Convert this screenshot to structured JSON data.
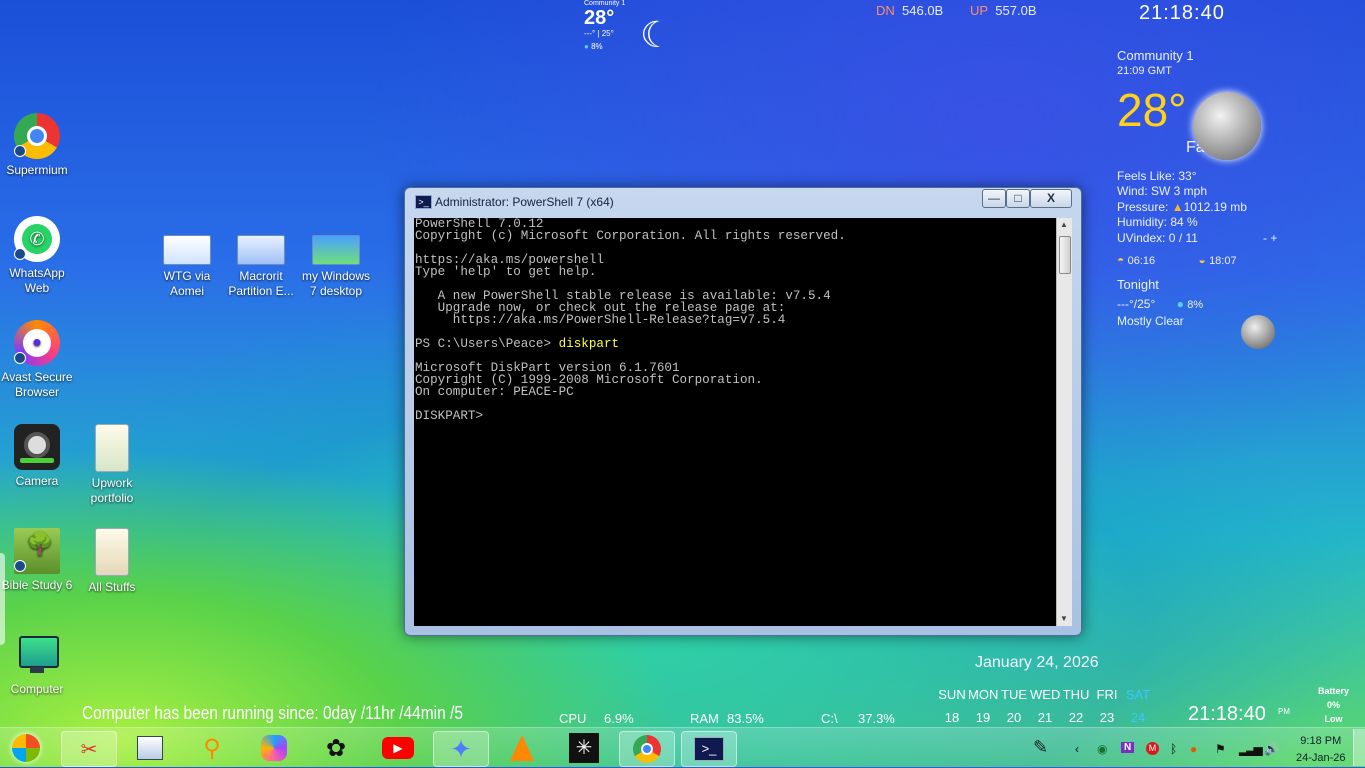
{
  "desktop_icons": [
    {
      "label": "Supermium"
    },
    {
      "label": "WhatsApp Web"
    },
    {
      "label": "Avast Secure Browser"
    },
    {
      "label": "Camera"
    },
    {
      "label": "Bible Study 6"
    },
    {
      "label": "Computer"
    },
    {
      "label": "WTG via Aomei"
    },
    {
      "label": "Macrorit Partition E..."
    },
    {
      "label": "my Windows 7 desktop"
    },
    {
      "label": "Upwork portfolio"
    },
    {
      "label": "All Stuffs"
    }
  ],
  "small_weather": {
    "location": "Community 1",
    "temp": "28°",
    "range": "---° | 25°",
    "precip": "8%"
  },
  "network": {
    "dn_label": "DN",
    "dn_value": "546.0B",
    "up_label": "UP",
    "up_value": "557.0B"
  },
  "clock_top": "21:18:40",
  "weather": {
    "location": "Community 1",
    "time": "21:09  GMT",
    "temp": "28°",
    "condition": "Fair",
    "feels_like": "Feels Like:  33°",
    "wind": "Wind:  SW 3 mph",
    "pressure": "Pressure:",
    "pressure_value": "1012.19 mb",
    "humidity": "Humidity:  84 %",
    "uv": "UVindex:   0 / 11",
    "uv_controls": "-   +",
    "sunrise": "06:16",
    "sunset": "18:07",
    "tonight_label": "Tonight",
    "tonight_temp": "---°/25°",
    "tonight_precip": "8%",
    "tonight_cond": "Mostly Clear"
  },
  "window": {
    "title": "Administrator: PowerShell 7 (x64)",
    "minimize": "—",
    "maximize": "□",
    "close": "X",
    "lines_before": "PowerShell 7.0.12\nCopyright (c) Microsoft Corporation. All rights reserved.\n\nhttps://aka.ms/powershell\nType 'help' to get help.\n\n   A new PowerShell stable release is available: v7.5.4\n   Upgrade now, or check out the release page at:\n     https://aka.ms/PowerShell-Release?tag=v7.5.4\n\nPS C:\\Users\\Peace> ",
    "command": "diskpart",
    "lines_after": "\n\nMicrosoft DiskPart version 6.1.7601\nCopyright (C) 1999-2008 Microsoft Corporation.\nOn computer: PEACE-PC\n\nDISKPART> "
  },
  "uptime": "Computer has been running since: 0day /11hr /44min /5",
  "stats": {
    "cpu_label": "CPU",
    "cpu": "6.9%",
    "ram_label": "RAM",
    "ram": "83.5%",
    "disk_label": "C:\\",
    "disk": "37.3%"
  },
  "calendar": {
    "date_long": "January 24, 2026",
    "days": [
      "SUN",
      "MON",
      "TUE",
      "WED",
      "THU",
      "FRI",
      "SAT"
    ],
    "dates": [
      "18",
      "19",
      "20",
      "21",
      "22",
      "23",
      "24"
    ]
  },
  "clock_bottom": "21:18:40",
  "clock_bottom_ampm": "PM",
  "battery": {
    "label": "Battery",
    "value": "0%",
    "status": "Low"
  },
  "tray_clock": {
    "time": "9:18 PM",
    "date": "24-Jan-26"
  },
  "colors": {
    "accent_yellow": "#ffd21a",
    "today": "#38c8ff",
    "console_bg": "#000000"
  }
}
